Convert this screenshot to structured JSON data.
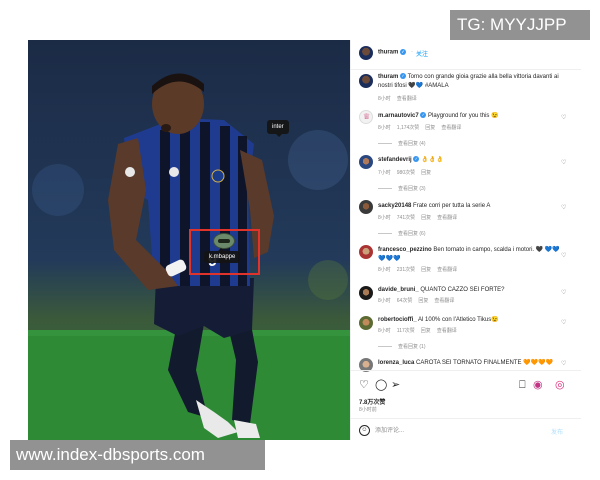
{
  "watermarks": {
    "telegram": "TG: MYYJJPP",
    "site": "www.index-dbsports.com"
  },
  "media": {
    "tags": {
      "inter": "inter",
      "mbappe": "k.mbappe"
    },
    "carousel": {
      "count": 3,
      "active_index": 1
    },
    "icons": {
      "next": "chevron-right-icon",
      "user_tags": "person-icon"
    }
  },
  "post_header": {
    "username": "thuram",
    "follow": "关注"
  },
  "caption": {
    "username": "thuram",
    "text": "Torno con grande gioia grazie alla bella vittoria davanti ai nostri tifosi 🖤💙 #AMALA",
    "time": "8小时",
    "translate": "查看翻译"
  },
  "comments": [
    {
      "username": "m.arnautovic7",
      "verified": true,
      "text": "Playground for you this 😉",
      "meta": [
        "8小时",
        "1,174次赞",
        "回复",
        "查看翻译"
      ],
      "replies": "查看回复 (4)"
    },
    {
      "username": "stefandevrij",
      "verified": true,
      "text": "👌👌👌",
      "meta": [
        "7小时",
        "980次赞",
        "回复"
      ],
      "replies": "查看回复 (3)"
    },
    {
      "username": "sacky20148",
      "verified": false,
      "text": "Frate corri per tutta la serie A",
      "meta": [
        "8小时",
        "741次赞",
        "回复",
        "查看翻译"
      ],
      "replies": "查看回复 (6)"
    },
    {
      "username": "francesco_pezzino",
      "verified": false,
      "text": "Ben tornato in campo, scalda i motori. 🖤 💙💙💙💙💙",
      "meta": [
        "8小时",
        "231次赞",
        "回复",
        "查看翻译"
      ],
      "replies": ""
    },
    {
      "username": "davide_bruni_",
      "verified": false,
      "text": "QUANTO CAZZO SEI FORTE?",
      "meta": [
        "8小时",
        "64次赞",
        "回复",
        "查看翻译"
      ],
      "replies": ""
    },
    {
      "username": "robertocioffi_",
      "verified": false,
      "text": "Al 100% con l'Atletico Tikus😉",
      "meta": [
        "8小时",
        "117次赞",
        "回复",
        "查看翻译"
      ],
      "replies": "查看回复 (1)"
    },
    {
      "username": "lorenza_luca",
      "verified": false,
      "text": "CAROTA SEI TORNATO FINALMENTE 🧡🧡🧡🧡",
      "meta": [],
      "replies": ""
    }
  ],
  "actions": {
    "icons": [
      "heart-icon",
      "comment-icon",
      "share-icon",
      "bookmark-icon",
      "save-icon",
      "share-story-icon"
    ]
  },
  "likes": "7.8万次赞",
  "date": "8小时前",
  "comment_box": {
    "placeholder": "添加评论...",
    "post": "发布"
  }
}
